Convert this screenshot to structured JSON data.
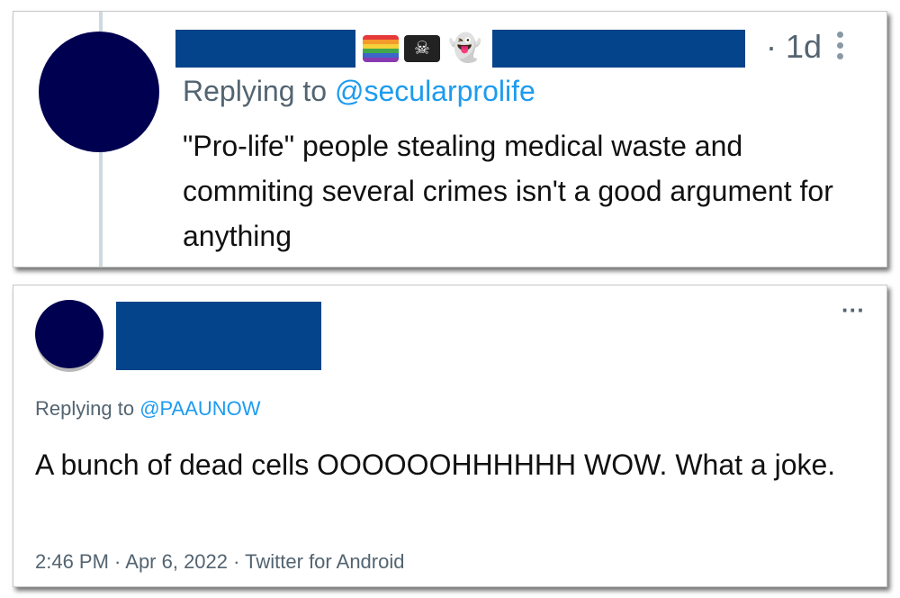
{
  "colors": {
    "redaction": "#04448a",
    "avatar": "#000050",
    "mention": "#1d9bf0",
    "secondary_text": "#536471"
  },
  "tweet1": {
    "emojis": [
      "rainbow-flag",
      "pirate-flag",
      "ghost"
    ],
    "pirate_glyph": "☠",
    "ghost_glyph": "👻",
    "timestamp": "· 1d",
    "replying_prefix": "Replying to ",
    "replying_handle": "@secularprolife",
    "text": "\"Pro-life\" people stealing medical waste and commiting several crimes isn't a good argument for anything"
  },
  "tweet2": {
    "more_glyph": "···",
    "replying_prefix": "Replying to ",
    "replying_handle": "@PAAUNOW",
    "text": "A bunch of dead cells OOOOOOHHHHHH WOW. What a joke.",
    "meta": "2:46 PM · Apr 6, 2022 · Twitter for Android"
  }
}
